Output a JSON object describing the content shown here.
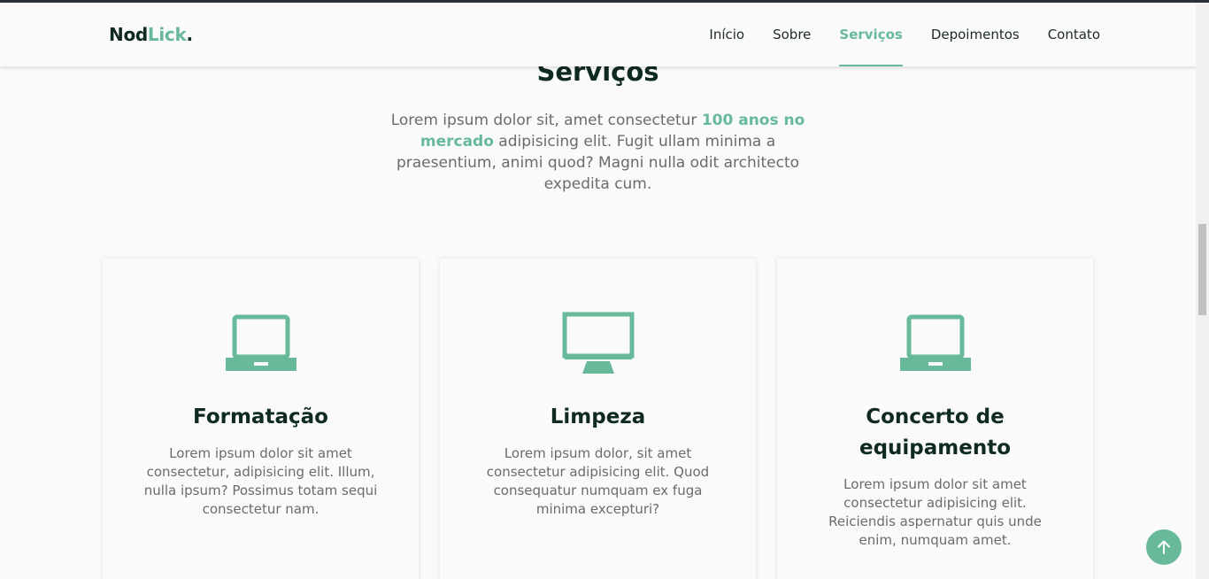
{
  "brand": {
    "name_part1": "Nod",
    "name_part2": "Lick",
    "name_dot": "."
  },
  "nav": {
    "items": [
      {
        "label": "Início"
      },
      {
        "label": "Sobre"
      },
      {
        "label": "Serviços",
        "active": true
      },
      {
        "label": "Depoimentos"
      },
      {
        "label": "Contato"
      }
    ]
  },
  "section": {
    "title": "Serviços",
    "desc_before": "Lorem ipsum dolor sit, amet consectetur ",
    "desc_highlight": "100 anos no mercado",
    "desc_after": " adipisicing elit. Fugit ullam minima a praesentium, animi quod? Magni nulla odit architecto expedita cum."
  },
  "cards": [
    {
      "icon": "laptop-icon",
      "title": "Formatação",
      "text": "Lorem ipsum dolor sit amet consectetur, adipisicing elit. Illum, nulla ipsum? Possimus totam sequi consectetur nam."
    },
    {
      "icon": "desktop-monitor-icon",
      "title": "Limpeza",
      "text": "Lorem ipsum dolor, sit amet consectetur adipisicing elit. Quod consequatur numquam ex fuga minima excepturi?"
    },
    {
      "icon": "laptop-icon",
      "title": "Concerto de equipamento",
      "text": "Lorem ipsum dolor sit amet consectetur adipisicing elit. Reiciendis aspernatur quis unde enim, numquam amet."
    }
  ],
  "scroll_top": {
    "icon": "arrow-up-icon"
  },
  "colors": {
    "accent": "#67b99a",
    "heading": "#0f2a20",
    "text": "#6b6b6b",
    "background": "#fafafa"
  }
}
